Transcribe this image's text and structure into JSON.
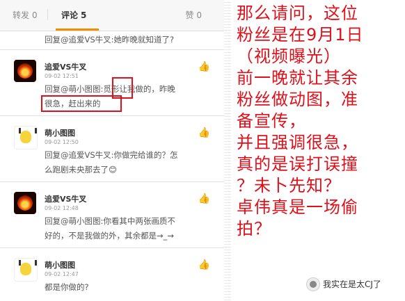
{
  "tabs": {
    "repost_label": "转发",
    "repost_count": "0",
    "comment_label": "评论",
    "comment_count": "5",
    "like_label": "赞",
    "like_count": "0"
  },
  "top_reply": "回复@追爱VS牛叉:她昨晚就知道了?",
  "comments": [
    {
      "author": "追爱VS牛叉",
      "time": "09-02 12:51",
      "text_line1": "回复@萌小图图:觅形让我做的，昨晚",
      "text_line2": "很急，赶出来的"
    },
    {
      "author": "萌小图图",
      "time": "09-02 12:50",
      "text_line1": "回复@追爱VS牛叉:你做完给谁的？怎",
      "text_line2": "么跑剧未央那去了😊"
    },
    {
      "author": "追爱VS牛叉",
      "time": "09-02 12:48",
      "text_line1": "回复@萌小图图:你看其中两张画质不",
      "text_line2": "好的，不是我做的外，其余都是→_→"
    },
    {
      "author": "萌小图图",
      "time": "09-02 12:47",
      "text_line1": "都是你做的?",
      "text_line2": ""
    }
  ],
  "commentary": {
    "text": "那么请问，这位\n粉丝是在9月1日\n（视频曝光）\n前一晚就让其余\n粉丝做动图，准\n备宣传，\n并且强调很急，\n真的是误打误撞\n？未卜先知？\n卓伟真是一场偷\n拍？"
  },
  "brand": {
    "text": "我实在是太CJ了"
  },
  "colors": {
    "accent_red": "#e0101a",
    "tab_orange": "#f18d00"
  }
}
